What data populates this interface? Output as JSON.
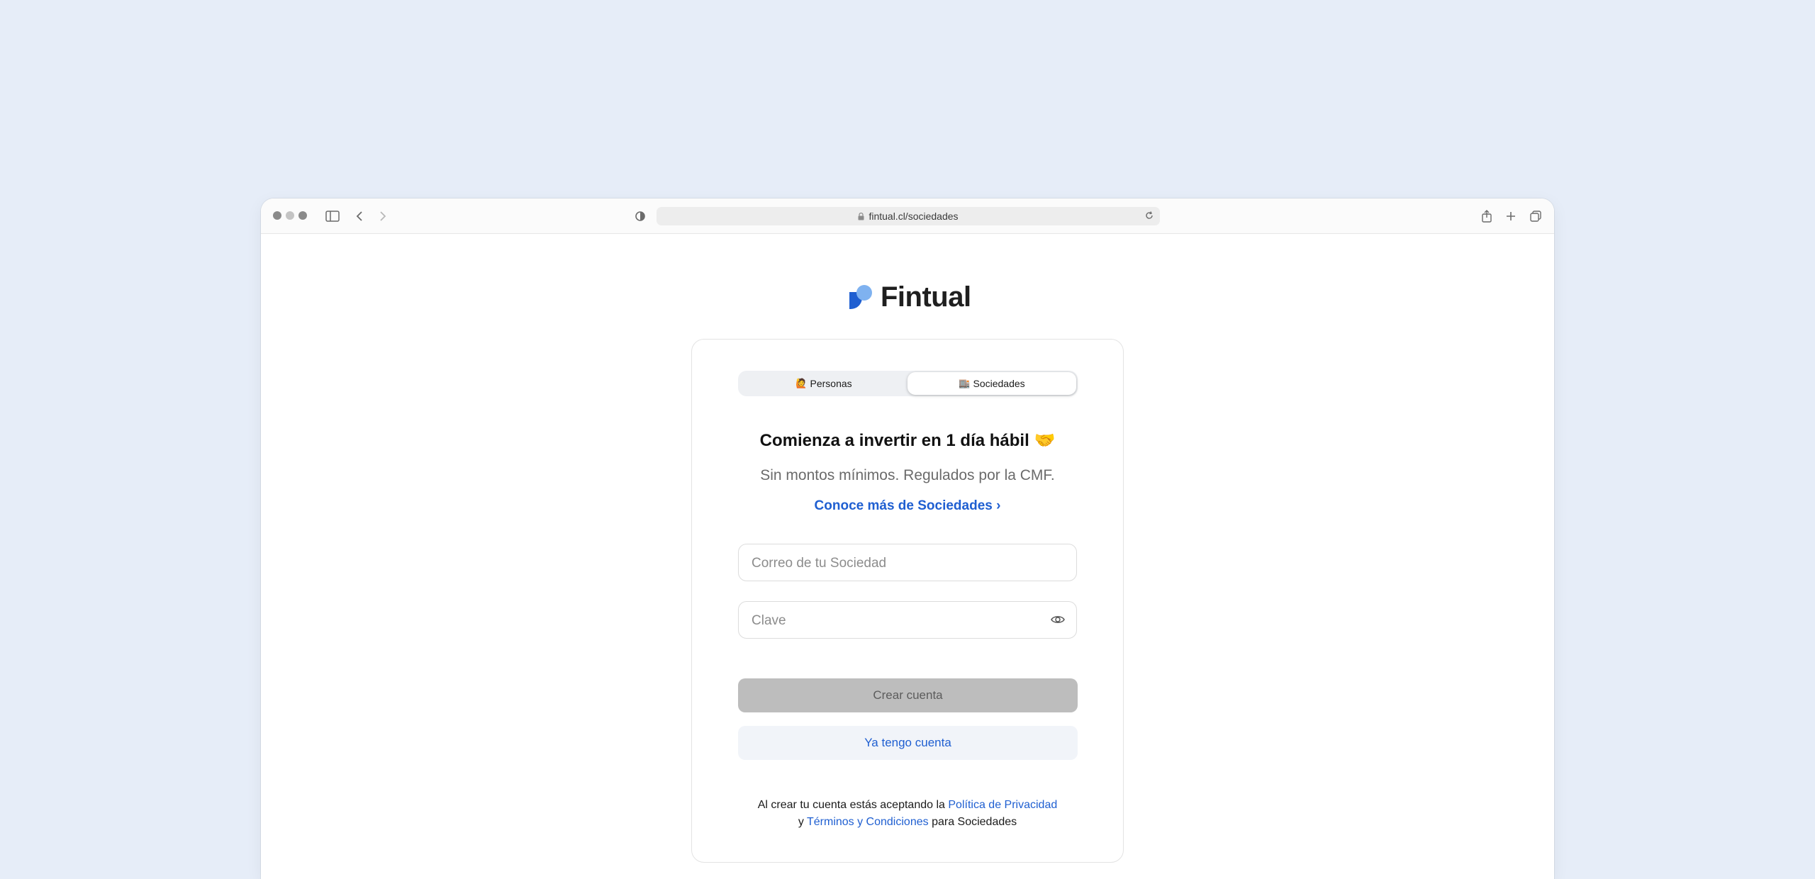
{
  "browser": {
    "url": "fintual.cl/sociedades",
    "icons": [
      "traffic-lights",
      "sidebar-icon",
      "back-icon",
      "forward-icon",
      "shield-icon",
      "lock-icon",
      "reload-icon",
      "share-icon",
      "new-tab-icon",
      "tabs-icon"
    ]
  },
  "brand": {
    "name": "Fintual",
    "color_primary": "#1f5fd1",
    "color_secondary": "#7fb2f0"
  },
  "tabs": {
    "personas": {
      "emoji": "🙋",
      "label": "Personas"
    },
    "sociedades": {
      "emoji": "🏬",
      "label": "Sociedades",
      "active": true
    }
  },
  "hero": {
    "title": "Comienza a invertir en 1 día hábil",
    "title_emoji": "🤝",
    "subtitle": "Sin montos mínimos. Regulados por la CMF.",
    "more_link": "Conoce más de Sociedades ›"
  },
  "form": {
    "email_placeholder": "Correo de tu Sociedad",
    "email_value": "",
    "password_placeholder": "Clave",
    "password_value": "",
    "create_label": "Crear cuenta",
    "login_label": "Ya tengo cuenta"
  },
  "legal": {
    "prefix": "Al crear tu cuenta estás aceptando la",
    "privacy_link": "Política de Privacidad",
    "and": "y",
    "terms_link": "Términos y Condiciones",
    "suffix": "para Sociedades"
  }
}
